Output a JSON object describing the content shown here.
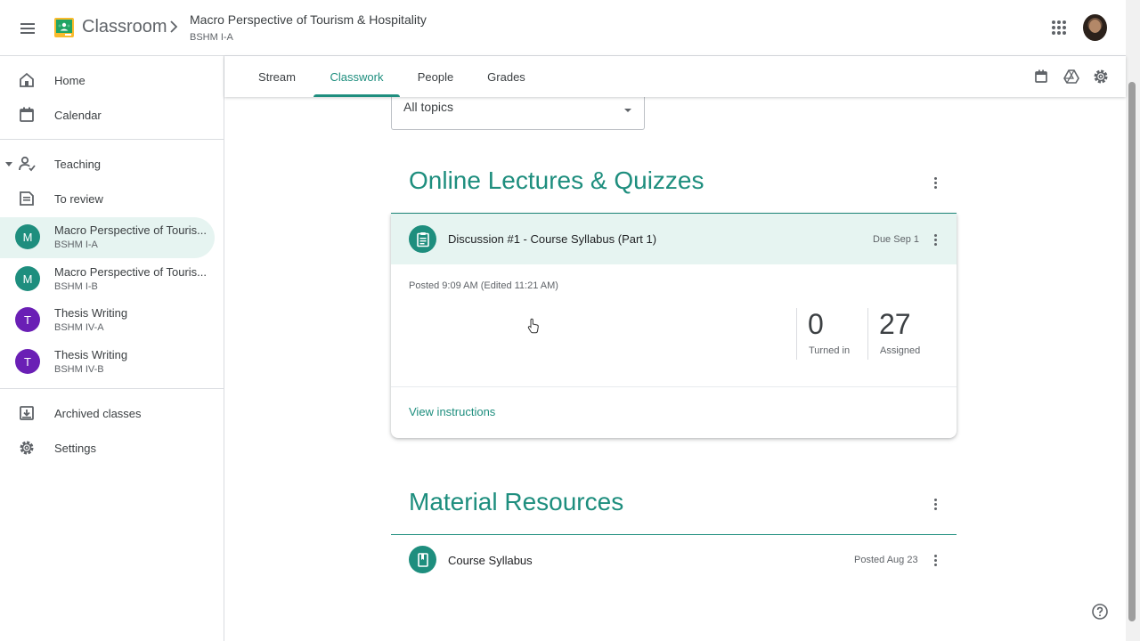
{
  "header": {
    "app_title": "Classroom",
    "class_title": "Macro Perspective of Tourism & Hospitality",
    "class_section": "BSHM I-A"
  },
  "sidebar": {
    "home": "Home",
    "calendar": "Calendar",
    "teaching": "Teaching",
    "to_review": "To review",
    "classes": [
      {
        "initial": "M",
        "name": "Macro Perspective of Touris...",
        "section": "BSHM I-A",
        "color": "#1e8e7e"
      },
      {
        "initial": "M",
        "name": "Macro Perspective of Touris...",
        "section": "BSHM I-B",
        "color": "#1e8e7e"
      },
      {
        "initial": "T",
        "name": "Thesis Writing",
        "section": "BSHM IV-A",
        "color": "#6a1fb5"
      },
      {
        "initial": "T",
        "name": "Thesis Writing",
        "section": "BSHM IV-B",
        "color": "#6a1fb5"
      }
    ],
    "archived": "Archived classes",
    "settings": "Settings"
  },
  "tabs": {
    "stream": "Stream",
    "classwork": "Classwork",
    "people": "People",
    "grades": "Grades"
  },
  "filter": {
    "selected": "All topics"
  },
  "topics": [
    {
      "heading": "Online Lectures & Quizzes",
      "item": {
        "title": "Discussion #1 - Course Syllabus (Part 1)",
        "due": "Due Sep 1",
        "posted": "Posted 9:09 AM (Edited 11:21 AM)",
        "turned_in_count": "0",
        "turned_in_label": "Turned in",
        "assigned_count": "27",
        "assigned_label": "Assigned",
        "link": "View instructions"
      }
    },
    {
      "heading": "Material Resources",
      "item": {
        "title": "Course Syllabus",
        "posted": "Posted Aug 23"
      }
    }
  ],
  "colors": {
    "accent": "#1e8e7e",
    "active_bg": "#e6f4f1",
    "purple": "#6a1fb5"
  }
}
